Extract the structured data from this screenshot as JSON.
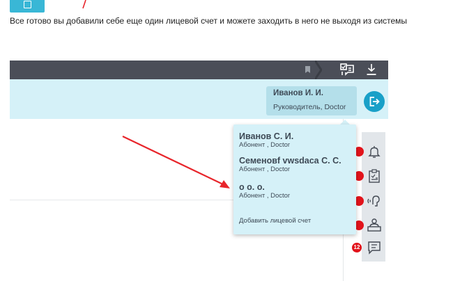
{
  "intro": {
    "text": "Все готово вы добавили себе еще один лицевой счет и можете заходить в него не выходя из системы"
  },
  "header": {
    "user_name": "Иванов И. И.",
    "user_role": "Руководитель, Doctor"
  },
  "dropdown": {
    "accounts": [
      {
        "name": "Иванов С. И.",
        "role": "Абонент , Doctor"
      },
      {
        "name": "Семеновf vwsdaca С. С.",
        "role": "Абонент , Doctor"
      },
      {
        "name": "о о. о.",
        "role": "Абонент , Doctor"
      }
    ],
    "add_label": "Добавить лицевой счет"
  },
  "sidebar": {
    "badges": [
      "",
      "",
      "",
      "",
      "12"
    ],
    "icons": [
      "bell-icon",
      "clipboard-icon",
      "voice-icon",
      "desk-icon",
      "message-icon"
    ]
  },
  "colors": {
    "accent": "#19a0c8",
    "header_bg": "#d5f1f8",
    "dark_bar": "#4b4e58",
    "badge": "#e2131b",
    "arrow": "#e8252b"
  }
}
